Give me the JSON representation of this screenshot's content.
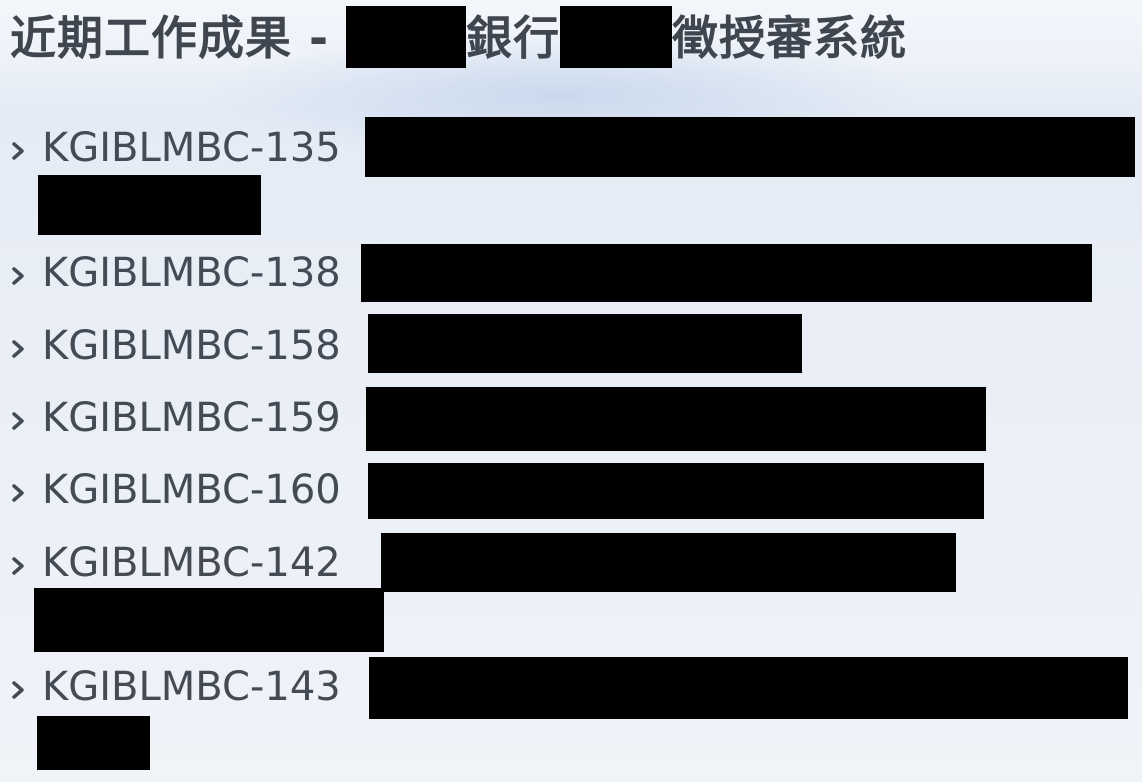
{
  "heading": {
    "prefix": "近期工作成果 - ",
    "middle": "銀行",
    "suffix": "徵授審系統"
  },
  "items": [
    {
      "code": "KGIBLMBC-135"
    },
    {
      "code": "KGIBLMBC-138"
    },
    {
      "code": "KGIBLMBC-158"
    },
    {
      "code": "KGIBLMBC-159"
    },
    {
      "code": "KGIBLMBC-160"
    },
    {
      "code": "KGIBLMBC-142"
    },
    {
      "code": "KGIBLMBC-143"
    }
  ],
  "icons": {
    "bullet": "chevron-right-icon"
  },
  "colors": {
    "text": "#454b55",
    "redaction": "#000000"
  }
}
